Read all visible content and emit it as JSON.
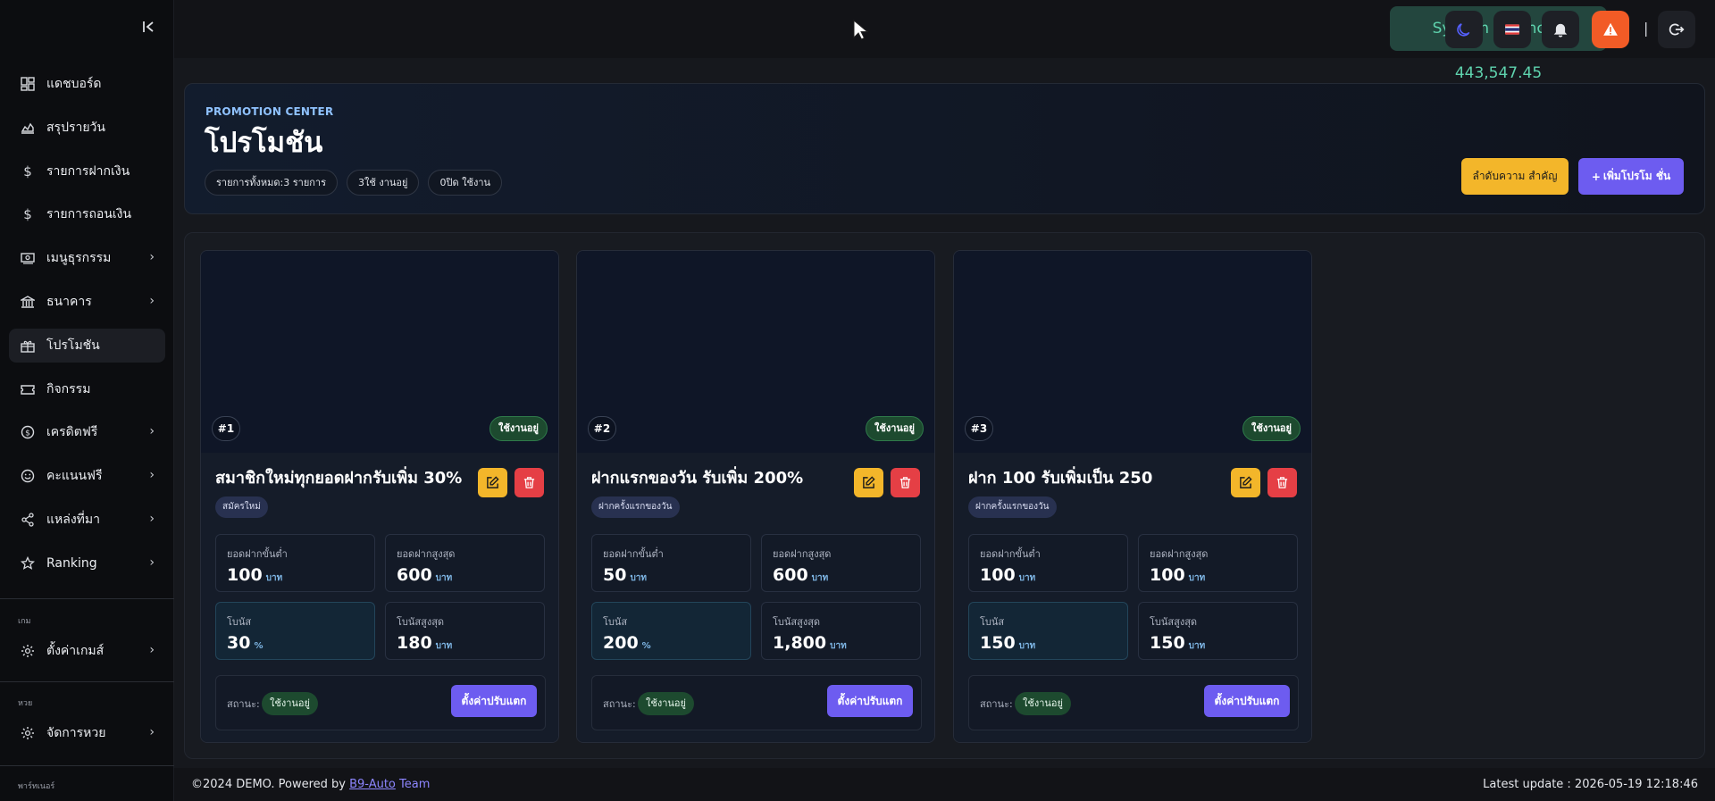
{
  "sidebar": {
    "collapse_icon": "collapse-left-icon",
    "items": [
      {
        "label": "แดชบอร์ด",
        "icon": "dashboard-icon",
        "chevron": false
      },
      {
        "label": "สรุปรายวัน",
        "icon": "chart-area-icon",
        "chevron": false
      },
      {
        "label": "รายการฝากเงิน",
        "icon": "dollar-icon",
        "chevron": false
      },
      {
        "label": "รายการถอนเงิน",
        "icon": "dollar-icon",
        "chevron": false
      },
      {
        "label": "เมนูธุรกรรม",
        "icon": "money-icon",
        "chevron": true
      },
      {
        "label": "ธนาคาร",
        "icon": "bank-icon",
        "chevron": true
      },
      {
        "label": "โปรโมชัน",
        "icon": "gift-icon",
        "chevron": false,
        "active": true
      },
      {
        "label": "กิจกรรม",
        "icon": "ticket-icon",
        "chevron": false
      },
      {
        "label": "เครดิตฟรี",
        "icon": "coin-icon",
        "chevron": true
      },
      {
        "label": "คะแนนฟรี",
        "icon": "smile-icon",
        "chevron": true
      },
      {
        "label": "แหล่งที่มา",
        "icon": "share-icon",
        "chevron": true
      },
      {
        "label": "Ranking",
        "icon": "star-icon",
        "chevron": true
      }
    ],
    "sections": [
      {
        "title": "เกม",
        "item": "ตั้งค่าเกมส์",
        "icon": "gear-icon"
      },
      {
        "title": "หวย",
        "item": "จัดการหวย",
        "icon": "gear-icon"
      },
      {
        "title": "พาร์ทเนอร์"
      }
    ]
  },
  "topbar": {
    "balance": "System Balance : 443,547.45",
    "buttons": [
      "moon-icon",
      "flag-icon",
      "bell-icon",
      "warning-icon",
      "logout-icon"
    ],
    "divider": "|"
  },
  "header": {
    "eyebrow": "PROMOTION CENTER",
    "title": "โปรโมชัน",
    "pills": [
      "รายการทั้งหมด:3 รายการ",
      "3ใช้ งานอยู่",
      "0ปิด ใช้งาน"
    ],
    "sort_button": "ลำดับความ สำคัญ",
    "add_button_plus": "+",
    "add_button": "เพิ่มโปรโม ชั่น"
  },
  "card_labels": {
    "min_deposit": "ยอดฝากขั้นต่ำ",
    "max_deposit": "ยอดฝากสูงสุด",
    "bonus": "โบนัส",
    "max_bonus": "โบนัสสูงสุด",
    "status": "สถานะ:",
    "adjust_button": "ตั้งค่าปรับแตก",
    "unit_baht": "บาท"
  },
  "promotions": [
    {
      "num": "#1",
      "status_top": "ใช้งานอยู่",
      "title": "สมาชิกใหม่ทุกยอดฝากรับเพิ่ม 30%",
      "tag": "สมัครใหม่",
      "min_deposit": "100",
      "min_unit": "บาท",
      "max_deposit": "600",
      "max_unit": "บาท",
      "bonus": "30",
      "bonus_unit": "%",
      "max_bonus": "180",
      "max_bonus_unit": "บาท",
      "status": "ใช้งานอยู่"
    },
    {
      "num": "#2",
      "status_top": "ใช้งานอยู่",
      "title": "ฝากแรกของวัน รับเพิ่ม 200%",
      "tag": "ฝากครั้งแรกของวัน",
      "min_deposit": "50",
      "min_unit": "บาท",
      "max_deposit": "600",
      "max_unit": "บาท",
      "bonus": "200",
      "bonus_unit": "%",
      "max_bonus": "1,800",
      "max_bonus_unit": "บาท",
      "status": "ใช้งานอยู่"
    },
    {
      "num": "#3",
      "status_top": "ใช้งานอยู่",
      "title": "ฝาก 100 รับเพิ่มเป็น 250",
      "tag": "ฝากครั้งแรกของวัน",
      "min_deposit": "100",
      "min_unit": "บาท",
      "max_deposit": "100",
      "max_unit": "บาท",
      "bonus": "150",
      "bonus_unit": "บาท",
      "max_bonus": "150",
      "max_bonus_unit": "บาท",
      "status": "ใช้งานอยู่"
    }
  ],
  "footer": {
    "prefix": "©2024 DEMO. Powered by ",
    "link": "B9-Auto",
    "suffix": " Team",
    "latest_update": "Latest update : 2026-05-19 12:18:46"
  }
}
